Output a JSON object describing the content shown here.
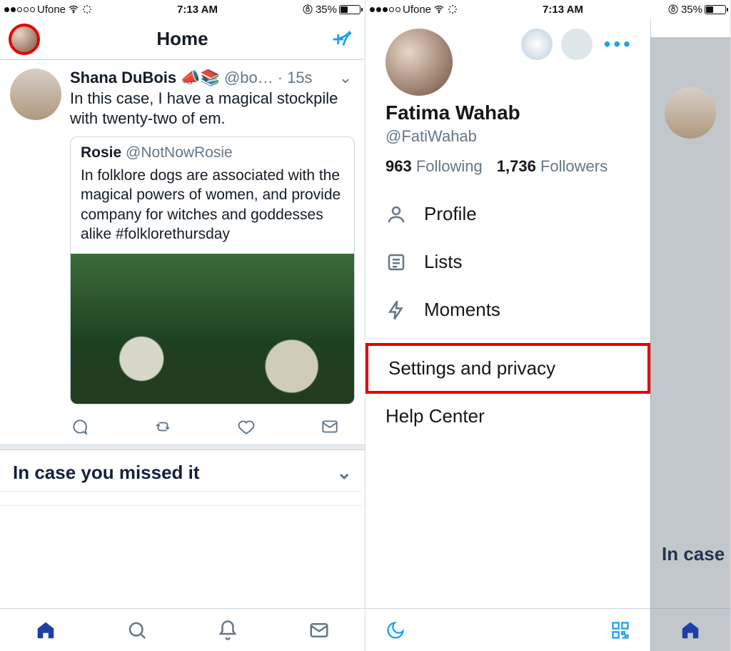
{
  "status": {
    "carrier": "Ufone",
    "time": "7:13 AM",
    "battery_pct": "35%"
  },
  "left": {
    "header_title": "Home",
    "tweet": {
      "name": "Shana DuBois",
      "emojis": "📣📚",
      "handle": "@bo…",
      "sep": "·",
      "time": "15s",
      "text": "In this case, I have a magical stockpile with twenty-two of em."
    },
    "quote": {
      "name": "Rosie",
      "handle": "@NotNowRosie",
      "text": "In folklore dogs are associated with the magical powers of women, and provide company for witches and goddesses alike #folklorethursday"
    },
    "missed_heading": "In case you missed it"
  },
  "right": {
    "profile_name": "Fatima Wahab",
    "profile_handle": "@FatiWahab",
    "following_count": "963",
    "following_label": " Following",
    "followers_count": "1,736",
    "followers_label": " Followers",
    "menu": {
      "profile": "Profile",
      "lists": "Lists",
      "moments": "Moments"
    },
    "settings": "Settings and privacy",
    "help": "Help Center",
    "dim_missed": "In case"
  }
}
